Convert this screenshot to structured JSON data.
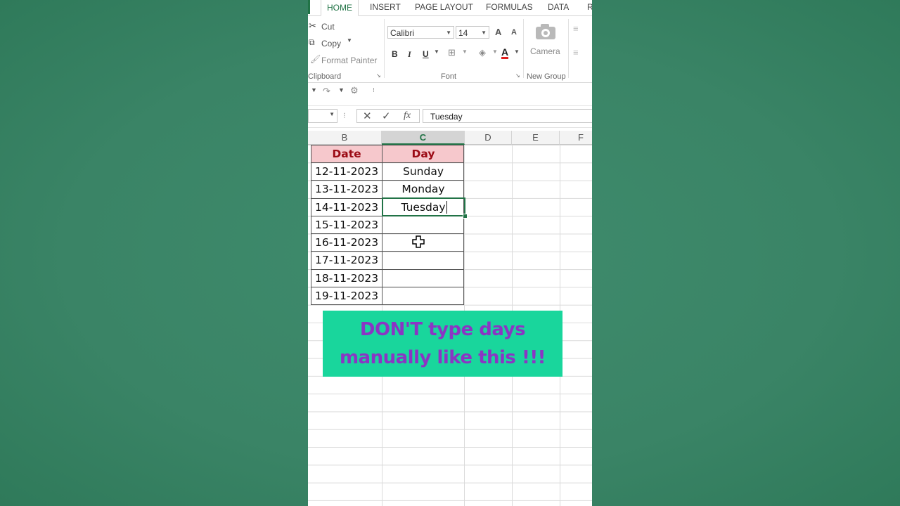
{
  "ribbon": {
    "tabs": [
      "HOME",
      "INSERT",
      "PAGE LAYOUT",
      "FORMULAS",
      "DATA",
      "R"
    ],
    "active_tab": "HOME",
    "clipboard": {
      "cut": "Cut",
      "copy": "Copy",
      "format_painter": "Format Painter",
      "group_label": "Clipboard"
    },
    "font": {
      "name": "Calibri",
      "size": "14",
      "group_label": "Font",
      "bold": "B",
      "italic": "I",
      "underline": "U",
      "grow": "A",
      "shrink": "A",
      "font_color": "A"
    },
    "new_group": {
      "camera": "Camera",
      "group_label": "New Group"
    }
  },
  "formula_bar": {
    "fx": "fx",
    "content": "Tuesday"
  },
  "sheet": {
    "columns": [
      "B",
      "C",
      "D",
      "E",
      "F"
    ],
    "selected_column": "C",
    "headers": [
      "Date",
      "Day"
    ],
    "rows": [
      {
        "date": "12-11-2023",
        "day": "Sunday"
      },
      {
        "date": "13-11-2023",
        "day": "Monday"
      },
      {
        "date": "14-11-2023",
        "day": "Tuesday"
      },
      {
        "date": "15-11-2023",
        "day": ""
      },
      {
        "date": "16-11-2023",
        "day": ""
      },
      {
        "date": "17-11-2023",
        "day": ""
      },
      {
        "date": "18-11-2023",
        "day": ""
      },
      {
        "date": "19-11-2023",
        "day": ""
      }
    ]
  },
  "banner": {
    "line1": "DON'T type days",
    "line2": "manually like this !!!"
  },
  "colors": {
    "excel_green": "#217346",
    "header_fill": "#f6c8cc",
    "header_text": "#9b0a14",
    "banner_bg": "#19d69c",
    "banner_text": "#8b35c4",
    "background": "#3a8466"
  }
}
